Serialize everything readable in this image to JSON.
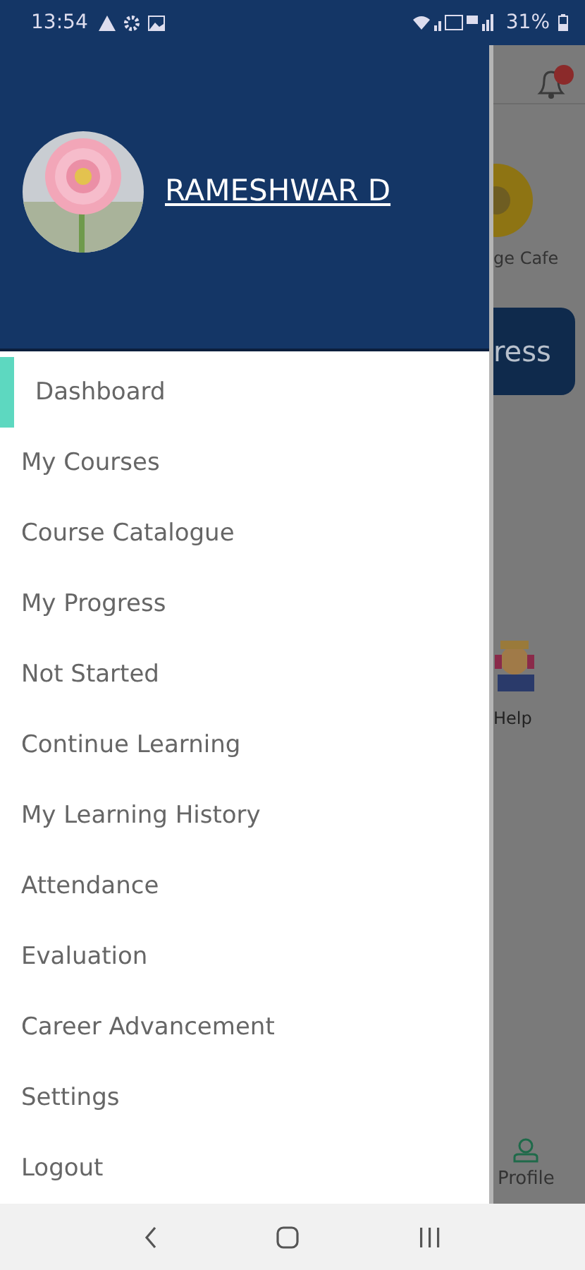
{
  "status_bar": {
    "time": "13:54",
    "battery": "31%"
  },
  "drawer": {
    "user_name": "RAMESHWAR D",
    "items": [
      {
        "label": "Dashboard",
        "selected": true
      },
      {
        "label": "My Courses",
        "selected": false
      },
      {
        "label": "Course Catalogue",
        "selected": false
      },
      {
        "label": "My Progress",
        "selected": false
      },
      {
        "label": "Not Started",
        "selected": false
      },
      {
        "label": "Continue Learning",
        "selected": false
      },
      {
        "label": "My Learning History",
        "selected": false
      },
      {
        "label": "Attendance",
        "selected": false
      },
      {
        "label": "Evaluation",
        "selected": false
      },
      {
        "label": "Career Advancement",
        "selected": false
      },
      {
        "label": "Settings",
        "selected": false
      },
      {
        "label": "Logout",
        "selected": false
      }
    ]
  },
  "background": {
    "cafe_label": "ge Cafe",
    "progress_button": "ress",
    "help_label": "Help",
    "profile_label": "Profile"
  }
}
